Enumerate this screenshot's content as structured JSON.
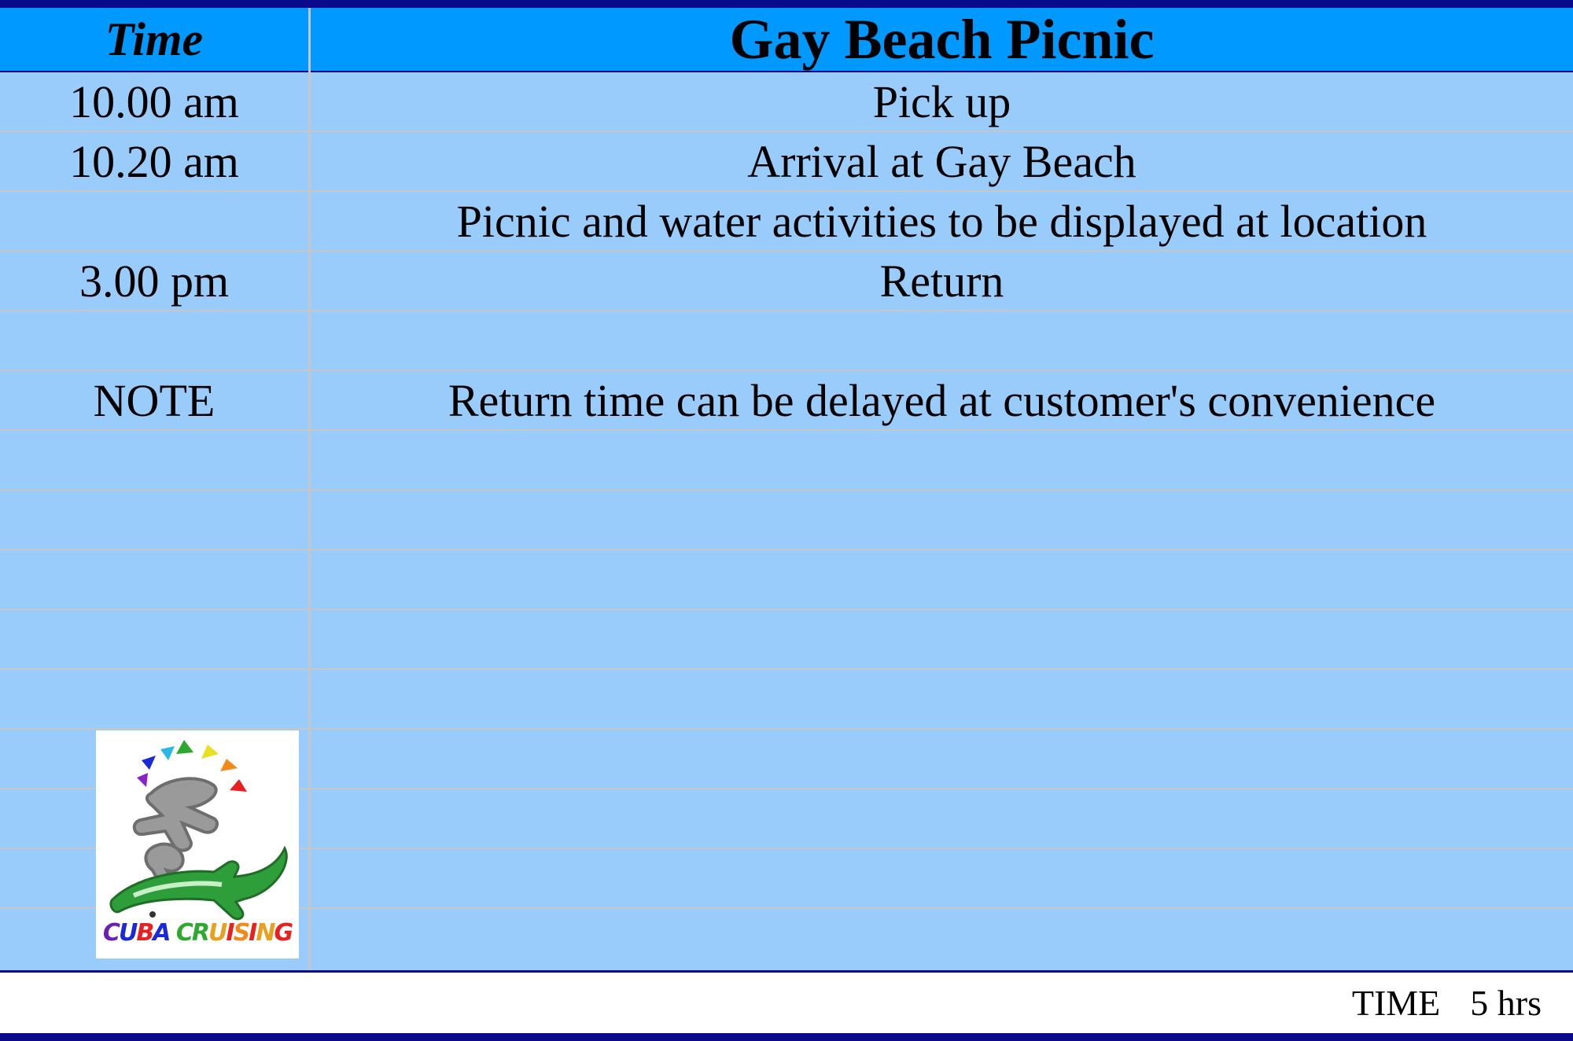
{
  "header": {
    "time_label": "Time",
    "title": "Gay Beach Picnic"
  },
  "rows": [
    {
      "time": "10.00 am",
      "activity": "Pick up"
    },
    {
      "time": "10.20 am",
      "activity": "Arrival at Gay Beach"
    },
    {
      "time": "",
      "activity": "Picnic and water activities to be displayed at location"
    },
    {
      "time": "3.00 pm",
      "activity": "Return"
    },
    {
      "time": "",
      "activity": ""
    },
    {
      "time": "NOTE",
      "activity": "Return time can be delayed at customer's convenience"
    },
    {
      "time": "",
      "activity": ""
    },
    {
      "time": "",
      "activity": ""
    },
    {
      "time": "",
      "activity": ""
    },
    {
      "time": "",
      "activity": ""
    },
    {
      "time": "",
      "activity": ""
    },
    {
      "time": "",
      "activity": ""
    },
    {
      "time": "",
      "activity": ""
    },
    {
      "time": "",
      "activity": ""
    },
    {
      "time": "",
      "activity": ""
    }
  ],
  "footer": {
    "total_label": "TIME",
    "total_value": "5 hrs"
  },
  "logo": {
    "text": "CUBA CRUISING",
    "icon": "rainbow-sun-arrow-logo-icon"
  },
  "colors": {
    "header_bg": "#0099ff",
    "body_bg": "#99ccfa",
    "border_dark": "#0a0a8a",
    "grid_line": "#c6c6c6"
  }
}
